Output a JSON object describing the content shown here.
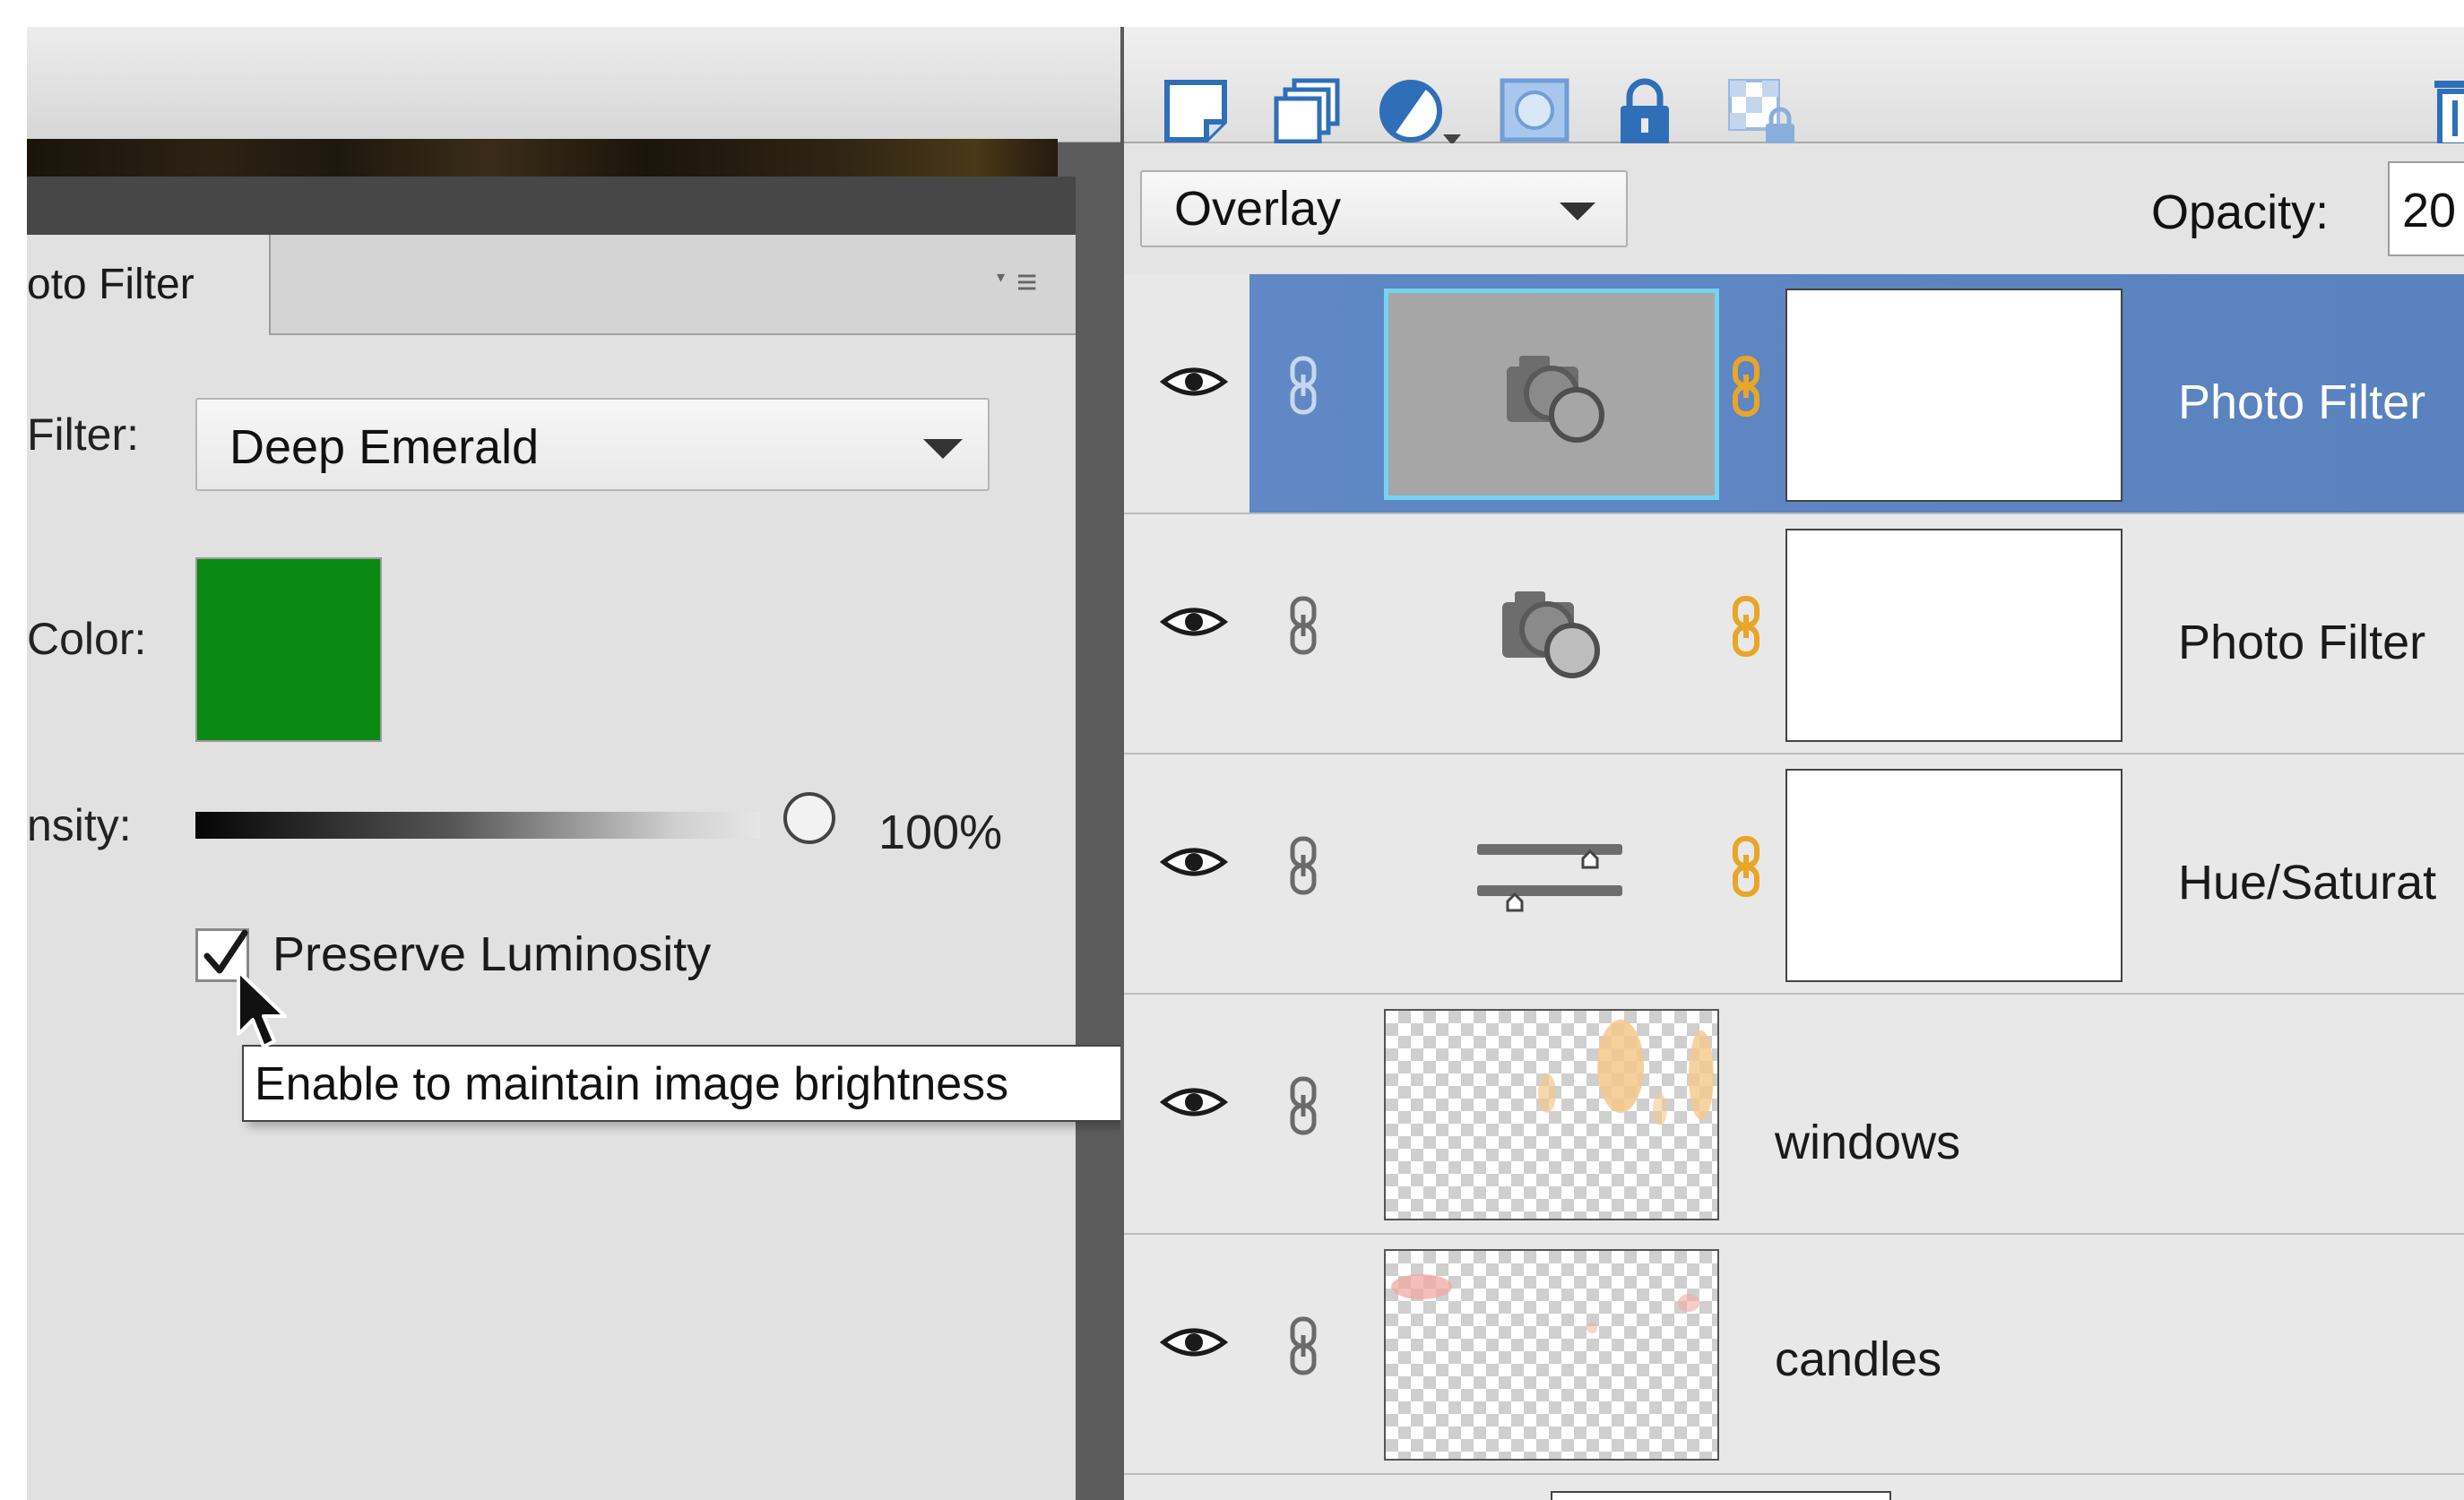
{
  "photo_filter_panel": {
    "tab_label": "oto Filter",
    "filter_label": "Filter:",
    "filter_value": "Deep Emerald",
    "color_label": "Color:",
    "color_value": "#0a8a12",
    "density_label": "nsity:",
    "density_value": "100%",
    "density_fraction": 1.0,
    "preserve_label": "Preserve Luminosity",
    "preserve_checked": true,
    "tooltip": "Enable to maintain image brightness",
    "menu_icon": "panel-menu-icon"
  },
  "layers_panel": {
    "toolbar_icons": [
      "new-layer-icon",
      "new-group-icon",
      "adjustment-layer-icon",
      "layer-mask-icon",
      "lock-all-icon",
      "lock-transparency-icon",
      "trash-icon"
    ],
    "blend_mode": "Overlay",
    "opacity_label": "Opacity:",
    "opacity_value": "20",
    "layers": [
      {
        "name": "Photo Filter",
        "selected": true,
        "type": "photo-filter"
      },
      {
        "name": "Photo Filter",
        "selected": false,
        "type": "photo-filter"
      },
      {
        "name": "Hue/Saturat",
        "selected": false,
        "type": "hue-saturation"
      },
      {
        "name": "windows",
        "selected": false,
        "type": "pixel"
      },
      {
        "name": "candles",
        "selected": false,
        "type": "pixel"
      }
    ]
  },
  "colors": {
    "selection": "#5f88c4",
    "selected_thumb_border": "#74d4f0",
    "link_orange": "#e9a526",
    "toolbar_icon_blue": "#2f6fb8"
  }
}
